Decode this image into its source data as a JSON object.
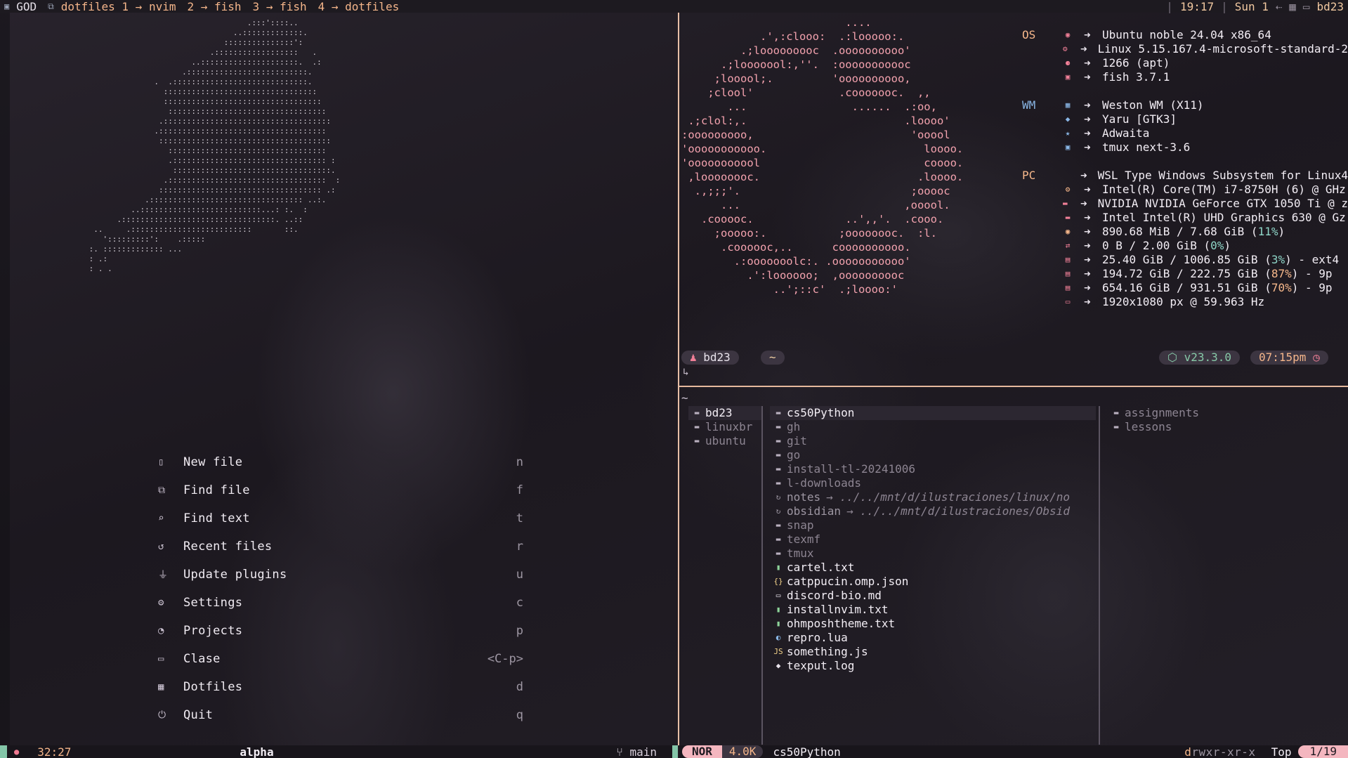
{
  "topbar": {
    "session": "GOD",
    "windows": [
      {
        "label": "dotfiles",
        "index": "1",
        "cmd": "nvim"
      },
      {
        "label": "2",
        "cmd": "fish"
      },
      {
        "label": "3",
        "cmd": "fish"
      },
      {
        "label": "4",
        "cmd": "dotfiles"
      }
    ],
    "win1_text": "dotfiles 1 → nvim",
    "win2_text": "2 → fish",
    "win3_text": "3 → fish",
    "win4_text": "4 → dotfiles",
    "time": "19:17",
    "date": "Sun 1",
    "host": "bd23"
  },
  "ascii_art": "                                   .:::'::::..\n                                ..:::::::::::::.\n                              :::::::::::::::':\n                           .::::::::::::::::::   .\n                       ..:::::::::::::::::::::.  .:\n                     .::::::::::::::::::::::::::.\n               .  .:::::::::::::::::::::::::::::.\n                 :::::::::::::::::::::::::::::::::\n                 ::::::::::::::::::::::::::::::::::\n                  ::::::::::::::::::::::::::::::::::\n                .::::::::::::::::::::::::::::::::::::\n               .::::::::::::::::::::::::::::::::::::\n                :::::::::::::::::::::::::::::::::::::\n                  ::::::::::::::::::::::::::::::::::\n                  .::::::::::::::::::::::::::::::::: :\n                   ::::::::::::::::::::::::::::::::::.\n                 .::::::::::::::::::::::::::::::::::  :\n                ::::::::::::::::::::::::::::::::::: .:\n             .::::::::::::::::::::::::::::::::: ..:.\n          ..::::::::::::::::::::::::::...: :.  :\n       .:::::::::::::::::::::::::::::::::. ..::\n  ..     .::::::::::::::::::::::::::       ::.\n    ':::::::::':    .:::::\n :. ::::::::::::: ...\n : .:\n : . .",
  "dashboard": {
    "items": [
      {
        "label": "New file",
        "key": "n",
        "icon": "file-icon"
      },
      {
        "label": "Find file",
        "key": "f",
        "icon": "files-icon"
      },
      {
        "label": "Find text",
        "key": "t",
        "icon": "search-text-icon"
      },
      {
        "label": "Recent files",
        "key": "r",
        "icon": "history-icon"
      },
      {
        "label": "Update plugins",
        "key": "u",
        "icon": "plug-icon"
      },
      {
        "label": "Settings",
        "key": "c",
        "icon": "gear-icon"
      },
      {
        "label": "Projects",
        "key": "p",
        "icon": "github-icon"
      },
      {
        "label": "Clase",
        "key": "<C-p>",
        "icon": "folder-icon"
      },
      {
        "label": "Dotfiles",
        "key": "d",
        "icon": "grid-icon"
      },
      {
        "label": "Quit",
        "key": "q",
        "icon": "power-icon"
      }
    ]
  },
  "left_status": {
    "position": "32:27",
    "filetype": "alpha",
    "branch": "main"
  },
  "ubuntu_logo": "                         ....\n            .',:clooo:  .:looooo:.\n         .;looooooooc  .oooooooooo'\n      .;looooool:,''.  :ooooooooooc\n     ;looool;.         'oooooooooo,\n    ;clool'             .cooooooc.  ,,\n       ...                ......  .:oo,\n .;clol:,.                        .loooo'\n:ooooooooo,                        'ooool\n'ooooooooooo.                        loooo.\n'ooooooooool                         coooo.\n ,loooooooc.                        .loooo.\n  .,;;;'.                          ;ooooc\n      ...                         ,ooool.\n   .cooooc.              ..',,'.  .cooo.\n     ;ooooo:.           ;oooooooc.  :l.\n      .coooooc,..      coooooooooo.\n        .:ooooooolc:. .ooooooooooo'\n          .':loooooo;  ,oooooooooc\n              ..';::c'  .;loooo:'",
  "fastfetch": {
    "sections": [
      {
        "cat": "OS",
        "rows": [
          {
            "icon": "ubuntu-icon",
            "value": "Ubuntu noble 24.04 x86_64"
          },
          {
            "icon": "gear-icon",
            "value": "Linux 5.15.167.4-microsoft-standard-2"
          },
          {
            "icon": "package-icon",
            "value": "1266 (apt)"
          },
          {
            "icon": "terminal-icon",
            "value": "fish 3.7.1"
          }
        ]
      },
      {
        "cat": "WM",
        "rows": [
          {
            "icon": "windows-icon",
            "value": "Weston WM (X11)"
          },
          {
            "icon": "palette-icon",
            "value": "Yaru [GTK3]"
          },
          {
            "icon": "cursor-icon",
            "value": "Adwaita"
          },
          {
            "icon": "terminal-icon",
            "value": "tmux next-3.6"
          }
        ]
      },
      {
        "cat": "PC",
        "rows": [
          {
            "icon": "none",
            "value": " WSL Type Windows Subsystem for Linux4"
          },
          {
            "icon": "cpu-icon",
            "value": "Intel(R) Core(TM) i7-8750H (6) @  GHz"
          },
          {
            "icon": "gpu-icon",
            "value": "NVIDIA NVIDIA GeForce GTX 1050 Ti @ z"
          },
          {
            "icon": "gpu-icon",
            "value": "Intel Intel(R) UHD Graphics 630 @  Gz"
          },
          {
            "icon": "memory-icon",
            "value": "890.68 MiB / 7.68 GiB (",
            "pct": "11%",
            "tail": ")"
          },
          {
            "icon": "swap-icon",
            "value": "0 B / 2.00 GiB (",
            "pct": "0%",
            "tail": ")"
          },
          {
            "icon": "disk-icon",
            "value": "25.40 GiB / 1006.85 GiB (",
            "pct": "3%",
            "tail": ") - ext4"
          },
          {
            "icon": "disk-icon",
            "value": "194.72 GiB / 222.75 GiB (",
            "pct": "87%",
            "tail": ") - 9p",
            "warn": true
          },
          {
            "icon": "disk-icon",
            "value": "654.16 GiB / 931.51 GiB (",
            "pct": "70%",
            "tail": ") - 9p",
            "warn": true
          },
          {
            "icon": "monitor-icon",
            "value": "1920x1080 px @ 59.963 Hz"
          }
        ]
      }
    ]
  },
  "prompt": {
    "user": "bd23",
    "dir": "~",
    "node": "v23.3.0",
    "time": "07:15pm",
    "caret": "↳"
  },
  "yazi": {
    "path": "~",
    "parent": [
      {
        "name": "bd23",
        "selected": true
      },
      {
        "name": "linuxbr"
      },
      {
        "name": "ubuntu"
      }
    ],
    "current": [
      {
        "name": "cs50Python",
        "type": "dir",
        "selected": true
      },
      {
        "name": "gh",
        "type": "dir"
      },
      {
        "name": "git",
        "type": "dir"
      },
      {
        "name": "go",
        "type": "dir"
      },
      {
        "name": "install-tl-20241006",
        "type": "dir"
      },
      {
        "name": "l-downloads",
        "type": "dir"
      },
      {
        "name": "notes",
        "type": "link",
        "target": "→ ../../mnt/d/ilustraciones/linux/no"
      },
      {
        "name": "obsidian",
        "type": "link",
        "target": "→ ../../mnt/d/ilustraciones/Obsid"
      },
      {
        "name": "snap",
        "type": "dir"
      },
      {
        "name": "texmf",
        "type": "dir"
      },
      {
        "name": "tmux",
        "type": "dir"
      },
      {
        "name": "cartel.txt",
        "type": "txt"
      },
      {
        "name": "catppucin.omp.json",
        "type": "json"
      },
      {
        "name": "discord-bio.md",
        "type": "md"
      },
      {
        "name": "installnvim.txt",
        "type": "txt"
      },
      {
        "name": "ohmposhtheme.txt",
        "type": "txt"
      },
      {
        "name": "repro.lua",
        "type": "lua"
      },
      {
        "name": "something.js",
        "type": "js"
      },
      {
        "name": "texput.log",
        "type": "log"
      }
    ],
    "preview": [
      {
        "name": "assignments"
      },
      {
        "name": "lessons"
      }
    ]
  },
  "right_status": {
    "mode": "NOR",
    "size": "4.0K",
    "file": "cs50Python",
    "perm_d": "d",
    "perm_rest": "rwxr-xr-x",
    "scroll": "Top",
    "count": "1/19"
  }
}
